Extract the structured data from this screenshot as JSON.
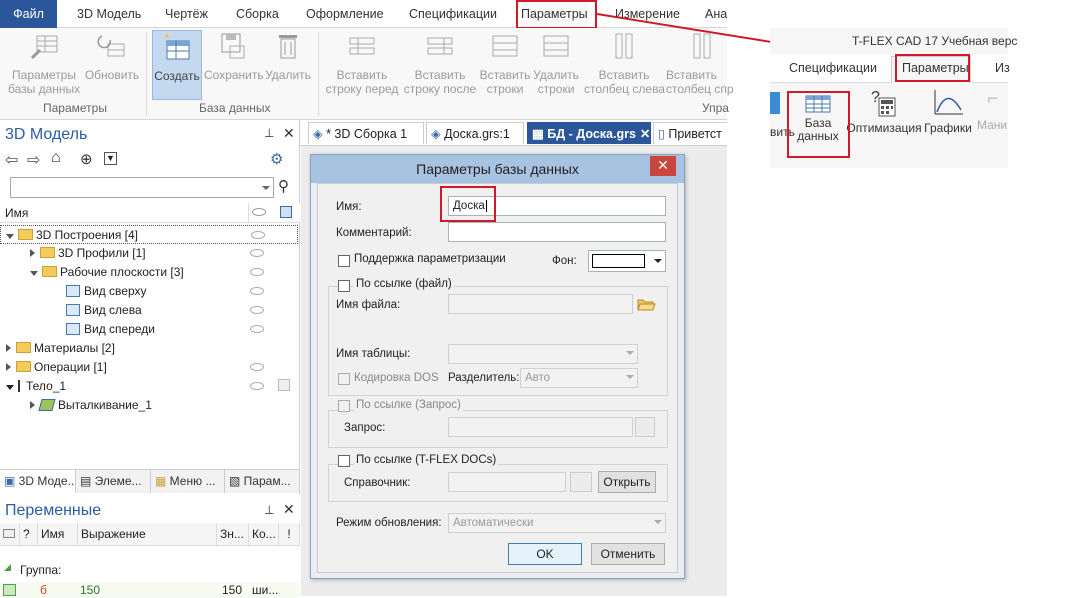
{
  "ribbon": {
    "tabs": [
      "Файл",
      "3D Модель",
      "Чертёж",
      "Сборка",
      "Оформление",
      "Спецификации",
      "Параметры",
      "Измерение",
      "Ана"
    ],
    "buttons": [
      {
        "label": "Параметры\nбазы данных",
        "enabled": false
      },
      {
        "label": "Обновить",
        "enabled": false
      },
      {
        "label": "Создать",
        "enabled": true
      },
      {
        "label": "Сохранить",
        "enabled": false
      },
      {
        "label": "Удалить",
        "enabled": false
      },
      {
        "label": "Вставить\nстроку перед",
        "enabled": false
      },
      {
        "label": "Вставить\nстроку после",
        "enabled": false
      },
      {
        "label": "Вставить\nстроки",
        "enabled": false
      },
      {
        "label": "Удалить\nстроки",
        "enabled": false
      },
      {
        "label": "Вставить\nстолбец слева",
        "enabled": false
      },
      {
        "label": "Вставить\nстолбец спр",
        "enabled": false
      }
    ],
    "groups": [
      "Параметры",
      "База данных",
      "Упра"
    ]
  },
  "model_panel": {
    "title": "3D Модель",
    "col_name": "Имя",
    "tree": [
      {
        "label": "3D Построения [4]",
        "level": 0,
        "icon": "folder"
      },
      {
        "label": "3D Профили [1]",
        "level": 1,
        "icon": "folder"
      },
      {
        "label": "Рабочие плоскости [3]",
        "level": 1,
        "icon": "folder"
      },
      {
        "label": "Вид сверху",
        "level": 2,
        "icon": "plane"
      },
      {
        "label": "Вид слева",
        "level": 2,
        "icon": "plane"
      },
      {
        "label": "Вид спереди",
        "level": 2,
        "icon": "plane"
      },
      {
        "label": "Материалы [2]",
        "level": 0,
        "icon": "folder"
      },
      {
        "label": "Операции [1]",
        "level": 0,
        "icon": "folder"
      },
      {
        "label": "Тело_1",
        "level": 0,
        "icon": "none"
      },
      {
        "label": "Выталкивание_1",
        "level": 1,
        "icon": "extrude"
      }
    ],
    "bottom_tabs": [
      "3D Моде...",
      "Элеме...",
      "Меню ...",
      "Парам..."
    ]
  },
  "vars_panel": {
    "title": "Переменные",
    "columns": [
      "?",
      "Имя",
      "Выражение",
      "Зн...",
      "Ко...",
      "!"
    ],
    "group_label": "Группа:",
    "row": {
      "name": "б",
      "expr": "150",
      "val": "150",
      "comment": "ши..."
    }
  },
  "doc_tabs": [
    "* 3D Сборка 1",
    "Доска.grs:1",
    "БД - Доска.grs",
    "Приветст"
  ],
  "dialog": {
    "title": "Параметры базы данных",
    "name_label": "Имя:",
    "name_value": "Доска",
    "comment_label": "Комментарий:",
    "comment_value": "",
    "param_support": "Поддержка параметризации",
    "bg_label": "Фон:",
    "by_link_file": "По ссылке (файл)",
    "file_name_label": "Имя файла:",
    "table_name_label": "Имя таблицы:",
    "dos_encoding": "Кодировка DOS",
    "separator_label": "Разделитель:",
    "separator_value": "Авто",
    "by_link_query": "По ссылке (Запрос)",
    "query_label": "Запрос:",
    "by_link_docs": "По ссылке (T-FLEX DOCs)",
    "reference_label": "Справочник:",
    "open_button": "Открыть",
    "update_mode_label": "Режим обновления:",
    "update_mode_value": "Автоматически",
    "ok_button": "OK",
    "cancel_button": "Отменить"
  },
  "callout": {
    "app_title": "T-FLEX CAD 17 Учебная верс",
    "tabs": [
      "Спецификации",
      "Параметры",
      "Из"
    ],
    "buttons": [
      "вить",
      "База\nданных",
      "Оптимизация",
      "Графики",
      "Мани"
    ]
  },
  "colors": {
    "accent": "#2b579a",
    "highlight": "#d01a2a",
    "selected": "#c4d8ef"
  }
}
